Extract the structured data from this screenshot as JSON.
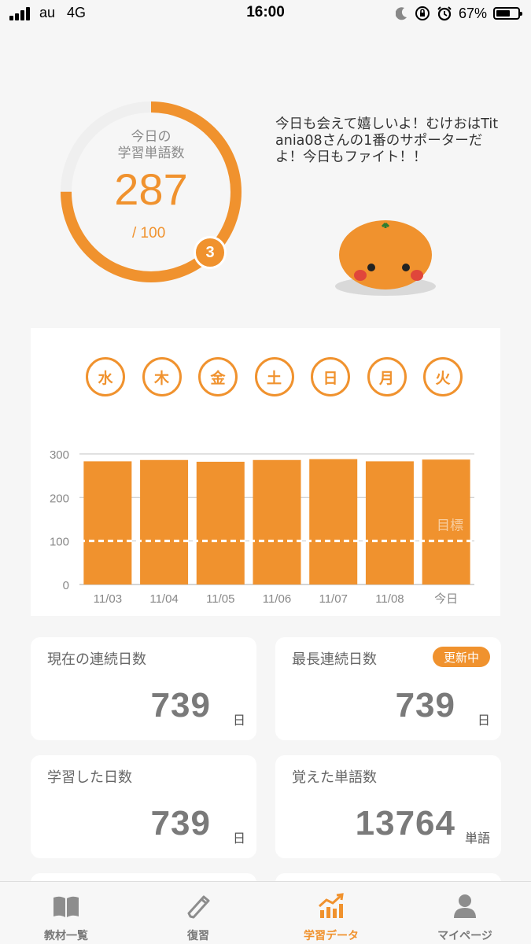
{
  "status_bar": {
    "carrier": "au",
    "network": "4G",
    "time": "16:00",
    "battery_text": "67%",
    "battery_level": 0.67,
    "signal_bars": 4
  },
  "hero": {
    "ring_label_line1": "今日の",
    "ring_label_line2": "学習単語数",
    "today_count": "287",
    "goal_text": "/ 100",
    "badge": "3",
    "progress_fraction": 0.75,
    "speech": "今日も会えて嬉しいよ！むけおはTitania08さんの1番のサポーターだよ！今日もファイト！！"
  },
  "weekdays": [
    "水",
    "木",
    "金",
    "土",
    "日",
    "月",
    "火"
  ],
  "chart_data": {
    "type": "bar",
    "categories": [
      "11/03",
      "11/04",
      "11/05",
      "11/06",
      "11/07",
      "11/08",
      "今日"
    ],
    "values": [
      283,
      286,
      282,
      286,
      288,
      283,
      287
    ],
    "ylim": [
      0,
      300
    ],
    "yticks": [
      0,
      100,
      200,
      300
    ],
    "target": 100,
    "target_label": "目標",
    "grid": true,
    "bar_color": "#f0922e"
  },
  "stats": {
    "streak": {
      "label": "現在の連続日数",
      "value": "739",
      "unit": "日"
    },
    "longest": {
      "label": "最長連続日数",
      "badge": "更新中",
      "value": "739",
      "unit": "日"
    },
    "days": {
      "label": "学習した日数",
      "value": "739",
      "unit": "日"
    },
    "words": {
      "label": "覚えた単語数",
      "value": "13764",
      "unit": "単語"
    }
  },
  "tabs": [
    {
      "label": "教材一覧",
      "icon": "book-icon"
    },
    {
      "label": "復習",
      "icon": "pencil-icon"
    },
    {
      "label": "学習データ",
      "icon": "chart-icon",
      "active": true
    },
    {
      "label": "マイページ",
      "icon": "person-icon"
    }
  ],
  "colors": {
    "accent": "#f0922e",
    "background": "#f6f6f6"
  }
}
